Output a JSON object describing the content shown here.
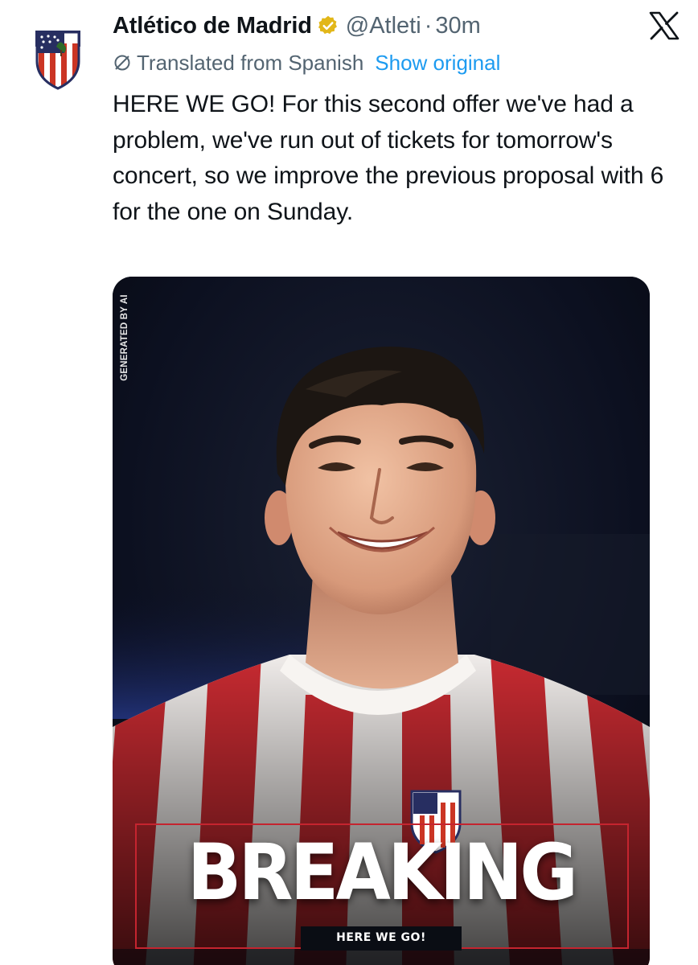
{
  "account": {
    "display_name": "Atlético de Madrid",
    "handle": "@Atleti",
    "separator": "·",
    "time": "30m",
    "verified": true
  },
  "translation": {
    "label": "Translated from Spanish",
    "show_original": "Show original"
  },
  "tweet": {
    "text": "HERE WE GO! For this second offer we've had a problem, we've run out of tickets for tomorrow's concert, so we improve the previous proposal with 6 for the one on Sunday."
  },
  "media": {
    "ai_tag": "GENERATED BY AI",
    "headline": "BREAKING",
    "subheadline": "HERE WE GO!"
  },
  "colors": {
    "link": "#1d9bf0",
    "secondary_text": "#536471",
    "primary_text": "#0f1419",
    "verified_gold": "#e2b719",
    "atleti_red": "#cb3524",
    "atleti_blue": "#272e61"
  },
  "icons": {
    "avatar": "atletico-crest-icon",
    "verified": "verified-badge-icon",
    "platform": "x-logo-icon",
    "translate": "globe-icon"
  }
}
